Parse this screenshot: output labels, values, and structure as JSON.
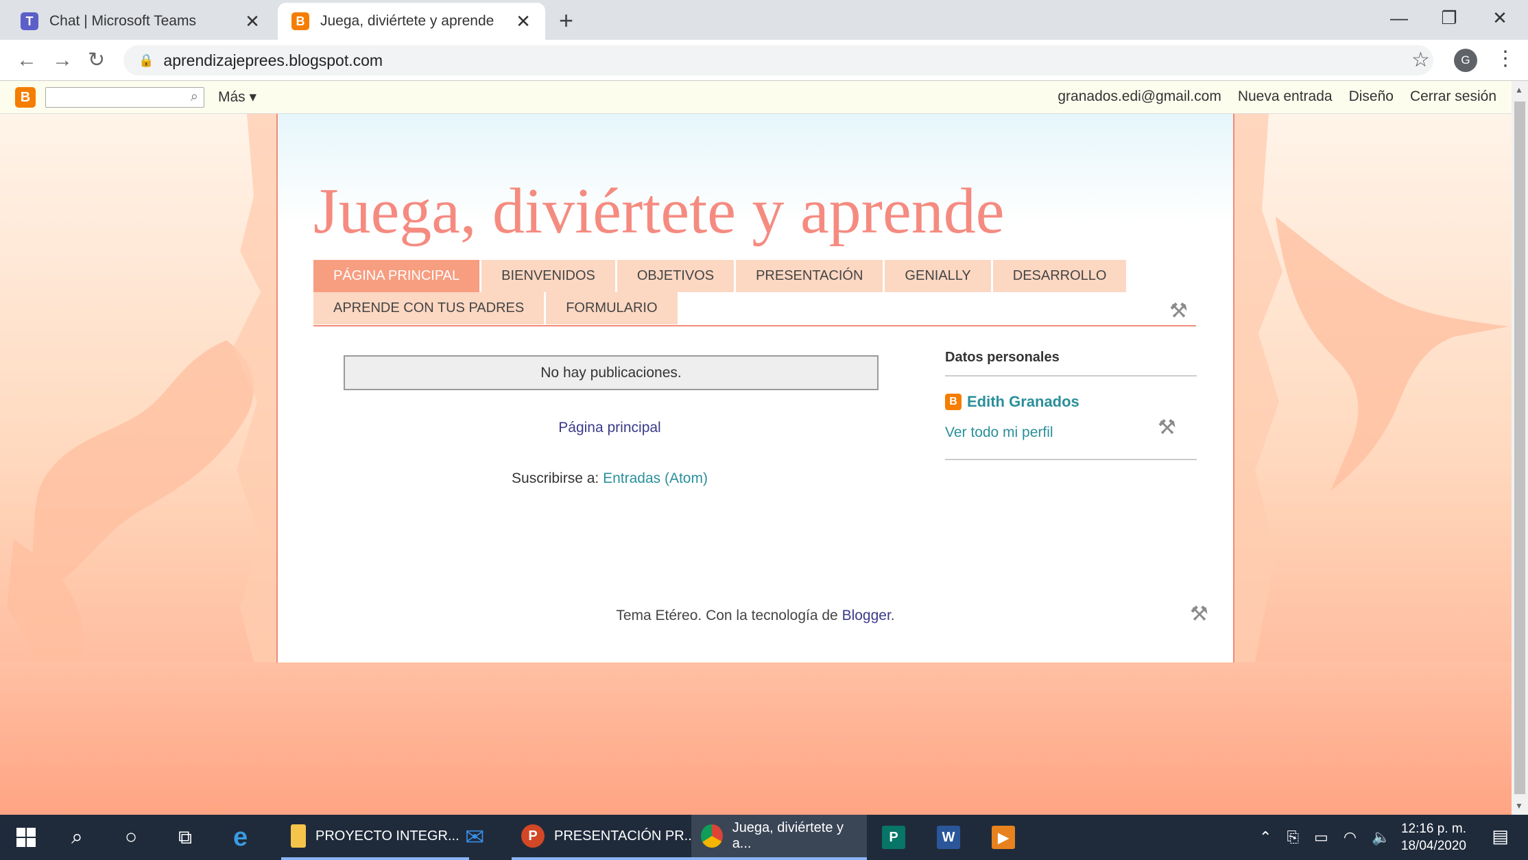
{
  "browser": {
    "tabs": [
      {
        "title": "Chat | Microsoft Teams",
        "active": false
      },
      {
        "title": "Juega, diviértete y aprende",
        "active": true
      }
    ],
    "url": "aprendizajeprees.blogspot.com",
    "profile_initial": "G"
  },
  "blogger_nav": {
    "more_label": "Más",
    "account_email": "granados.edi@gmail.com",
    "new_post": "Nueva entrada",
    "design": "Diseño",
    "sign_out": "Cerrar sesión"
  },
  "blog": {
    "title": "Juega, diviértete y aprende",
    "pages_row1": [
      "PÁGINA PRINCIPAL",
      "BIENVENIDOS",
      "OBJETIVOS",
      "PRESENTACIÓN",
      "GENIALLY",
      "DESARROLLO"
    ],
    "pages_row2": [
      "APRENDE CON TUS PADRES",
      "FORMULARIO"
    ],
    "no_posts": "No hay publicaciones.",
    "home_link": "Página principal",
    "subscribe_label": "Suscribirse a:",
    "subscribe_link": "Entradas (Atom)",
    "sidebar": {
      "heading": "Datos personales",
      "author": "Edith Granados",
      "profile_link": "Ver todo mi perfil"
    },
    "footer_text": "Tema Etéreo. Con la tecnología de",
    "footer_link": "Blogger",
    "footer_end": "."
  },
  "taskbar": {
    "apps": [
      {
        "label": "PROYECTO INTEGR..."
      },
      {
        "label": "PRESENTACIÓN PR..."
      },
      {
        "label": "Juega, diviértete y a..."
      }
    ],
    "time": "12:16 p. m.",
    "date": "18/04/2020"
  },
  "colors": {
    "title": "#f58b80",
    "tab_selected": "#f79d80",
    "tab": "#fcd7c2",
    "link_teal": "#2a8f9a",
    "taskbar": "#1f2b3b"
  }
}
